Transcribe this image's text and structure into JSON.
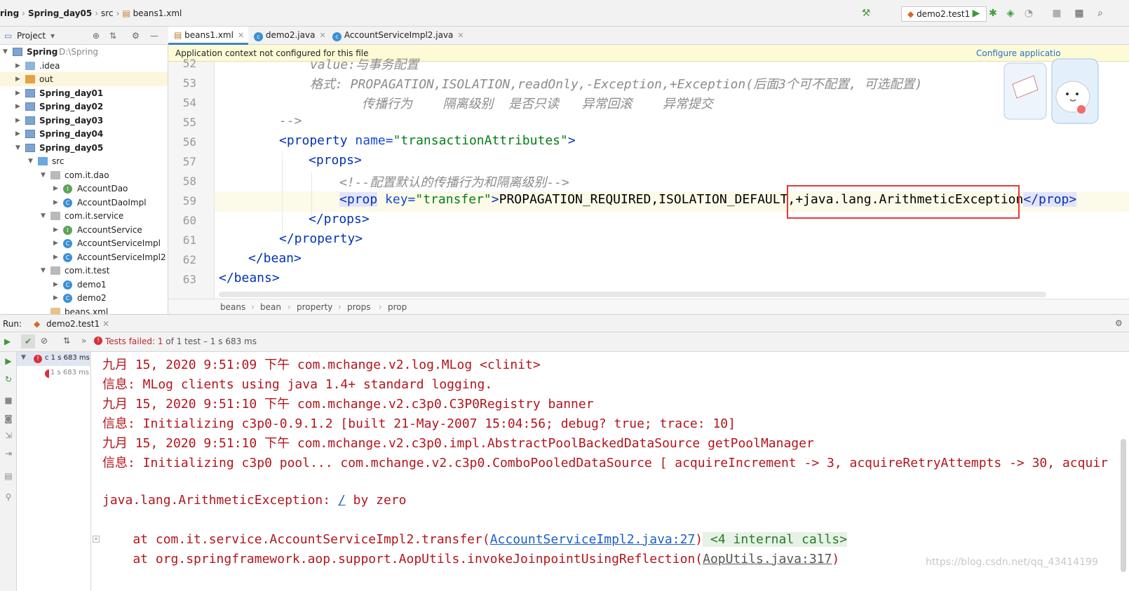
{
  "breadcrumb": [
    "ring",
    "Spring_day05",
    "src",
    "beans1.xml"
  ],
  "run_config": "demo2.test1",
  "project_panel": {
    "title": "Project"
  },
  "tree": [
    {
      "label": "Spring",
      "hint": "D:\\Spring",
      "depth": 0,
      "icon": "module",
      "bold": true,
      "open": true
    },
    {
      "label": ".idea",
      "depth": 1,
      "icon": "folder",
      "open": false
    },
    {
      "label": "out",
      "depth": 1,
      "icon": "out",
      "open": false
    },
    {
      "label": "Spring_day01",
      "depth": 1,
      "icon": "module",
      "bold": true,
      "open": false
    },
    {
      "label": "Spring_day02",
      "depth": 1,
      "icon": "module",
      "bold": true,
      "open": false
    },
    {
      "label": "Spring_day03",
      "depth": 1,
      "icon": "module",
      "bold": true,
      "open": false
    },
    {
      "label": "Spring_day04",
      "depth": 1,
      "icon": "module",
      "bold": true,
      "open": false
    },
    {
      "label": "Spring_day05",
      "depth": 1,
      "icon": "module",
      "bold": true,
      "open": true
    },
    {
      "label": "src",
      "depth": 2,
      "icon": "src",
      "open": true
    },
    {
      "label": "com.it.dao",
      "depth": 3,
      "icon": "pkg",
      "open": true
    },
    {
      "label": "AccountDao",
      "depth": 4,
      "icon": "I",
      "open": false
    },
    {
      "label": "AccountDaoImpl",
      "depth": 4,
      "icon": "C",
      "open": false
    },
    {
      "label": "com.it.service",
      "depth": 3,
      "icon": "pkg",
      "open": true
    },
    {
      "label": "AccountService",
      "depth": 4,
      "icon": "I",
      "open": false
    },
    {
      "label": "AccountServiceImpl",
      "depth": 4,
      "icon": "C",
      "open": false
    },
    {
      "label": "AccountServiceImpl2",
      "depth": 4,
      "icon": "C",
      "open": false
    },
    {
      "label": "com.it.test",
      "depth": 3,
      "icon": "pkg",
      "open": true
    },
    {
      "label": "demo1",
      "depth": 4,
      "icon": "C",
      "open": false
    },
    {
      "label": "demo2",
      "depth": 4,
      "icon": "C",
      "open": false
    },
    {
      "label": "beans.xml",
      "depth": 3,
      "icon": "xml",
      "open": null
    }
  ],
  "tabs": [
    {
      "label": "beans1.xml",
      "active": true
    },
    {
      "label": "demo2.java",
      "active": false
    },
    {
      "label": "AccountServiceImpl2.java",
      "active": false
    }
  ],
  "notice": {
    "text": "Application context not configured for this file",
    "link": "Configure applicatio"
  },
  "editor_lines": [
    {
      "num": "52",
      "text": "value:与事务配置",
      "kind": "comment"
    },
    {
      "num": "53",
      "text": "格式: PROPAGATION,ISOLATION,readOnly,-Exception,+Exception(后面3个可不配置, 可选配置)",
      "kind": "comment"
    },
    {
      "num": "54",
      "text": "传播行为    隔离级别  是否只读   异常回滚    异常提交",
      "kind": "comment"
    },
    {
      "num": "55",
      "text": "-->",
      "kind": "comment"
    },
    {
      "num": "56",
      "kind": "tag"
    },
    {
      "num": "57",
      "kind": "tag"
    },
    {
      "num": "58",
      "text": "<!--配置默认的传播行为和隔离级别-->",
      "kind": "comment"
    },
    {
      "num": "59",
      "kind": "tag"
    },
    {
      "num": "60",
      "kind": "tag"
    },
    {
      "num": "61",
      "kind": "tag"
    },
    {
      "num": "62",
      "kind": "tag"
    },
    {
      "num": "63",
      "kind": "tag"
    }
  ],
  "code": {
    "l56_tag": "<property",
    "l56_attr": "name=",
    "l56_val": "\"transactionAttributes\"",
    "l56_end": ">",
    "l57": "<props>",
    "l59_tag": "<prop",
    "l59_attr": "key=",
    "l59_val": "\"transfer\"",
    "l59_gt": ">",
    "l59_text": "PROPAGATION_REQUIRED,ISOLATION_DEFAULT,",
    "l59_boxed": "+java.lang.ArithmeticException",
    "l59_close": "</prop>",
    "l60": "</props>",
    "l61": "</property>",
    "l62": "</bean>",
    "l63": "</beans>"
  },
  "editor_breadcrumb": [
    "beans",
    "bean",
    "property",
    "props",
    "prop"
  ],
  "run": {
    "label": "Run:",
    "tab": "demo2.test1",
    "status_prefix": "Tests failed:",
    "status_count": "1",
    "status_rest": "of 1 test – 1 s 683 ms",
    "tree_root": "c 1 s 683 ms",
    "tree_child": "1 s 683 ms"
  },
  "console": [
    "九月 15, 2020 9:51:09 下午 com.mchange.v2.log.MLog <clinit>",
    "信息: MLog clients using java 1.4+ standard logging.",
    "九月 15, 2020 9:51:10 下午 com.mchange.v2.c3p0.C3P0Registry banner",
    "信息: Initializing c3p0-0.9.1.2 [built 21-May-2007 15:04:56; debug? true; trace: 10]",
    "九月 15, 2020 9:51:10 下午 com.mchange.v2.c3p0.impl.AbstractPoolBackedDataSource getPoolManager",
    "信息: Initializing c3p0 pool... com.mchange.v2.c3p0.ComboPooledDataSource [ acquireIncrement -> 3, acquireRetryAttempts -> 30, acquir"
  ],
  "exception": {
    "head": "java.lang.ArithmeticException: ",
    "link": "/",
    "tail": " by zero",
    "at1_pre": "    at com.it.service.AccountServiceImpl2.transfer(",
    "at1_link": "AccountServiceImpl2.java:27",
    "at1_post": ")",
    "at1_internal": " <4 internal calls>",
    "at2_pre": "    at org.springframework.aop.support.AopUtils.invokeJoinpointUsingReflection(",
    "at2_link": "AopUtils.java:317",
    "at2_post": ")"
  },
  "watermark": "https://blog.csdn.net/qq_43414199",
  "colors": {
    "accent": "#4083c9",
    "error": "#b3151c",
    "highlight_box": "#e53935"
  }
}
